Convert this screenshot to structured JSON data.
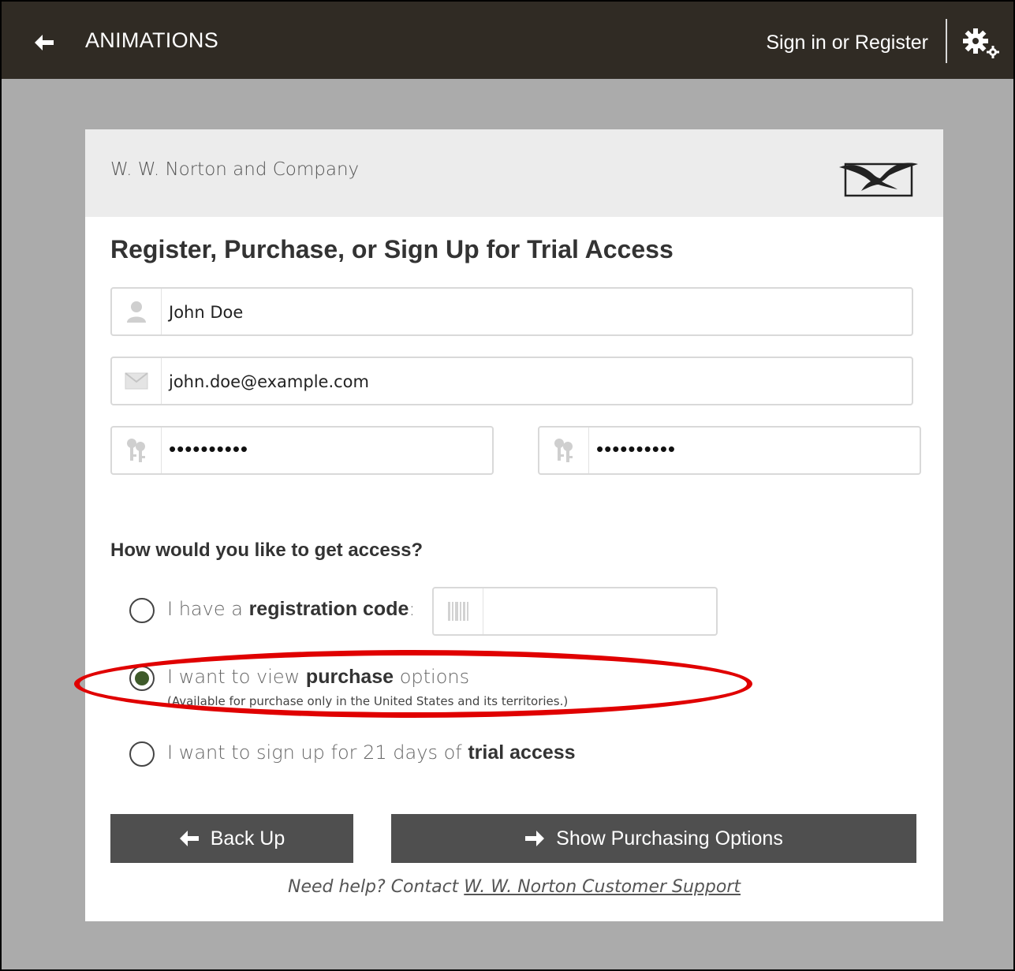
{
  "topbar": {
    "title": "ANIMATIONS",
    "signin_label": "Sign in or Register",
    "back_icon": "arrow-left-icon",
    "settings_icon": "gears-icon"
  },
  "card": {
    "publisher": "W. W. Norton and Company",
    "heading": "Register, Purchase, or Sign Up for Trial Access"
  },
  "form": {
    "name_value": "John Doe",
    "email_value": "john.doe@example.com",
    "password_value": "••••••••••",
    "password_confirm_value": "••••••••••"
  },
  "access": {
    "question": "How would you like to get access?",
    "option_code_pre": "I have a ",
    "option_code_bold": "registration code",
    "option_code_post": ":",
    "code_value": "",
    "option_purchase_pre": "I want to view ",
    "option_purchase_bold": "purchase",
    "option_purchase_post": " options",
    "option_purchase_note": "(Available for purchase only in the United States and its territories.)",
    "option_trial_pre": "I want to sign up for 21 days of ",
    "option_trial_bold": "trial access",
    "selected": "purchase"
  },
  "buttons": {
    "back_label": "Back Up",
    "show_label": "Show Purchasing Options"
  },
  "help": {
    "text": "Need help? Contact ",
    "link": "W. W. Norton Customer Support"
  },
  "colors": {
    "topbar": "#302b24",
    "background": "#ababab",
    "button": "#4f4f4f",
    "radio_selected": "#3e5a2a",
    "highlight": "#e00000"
  }
}
